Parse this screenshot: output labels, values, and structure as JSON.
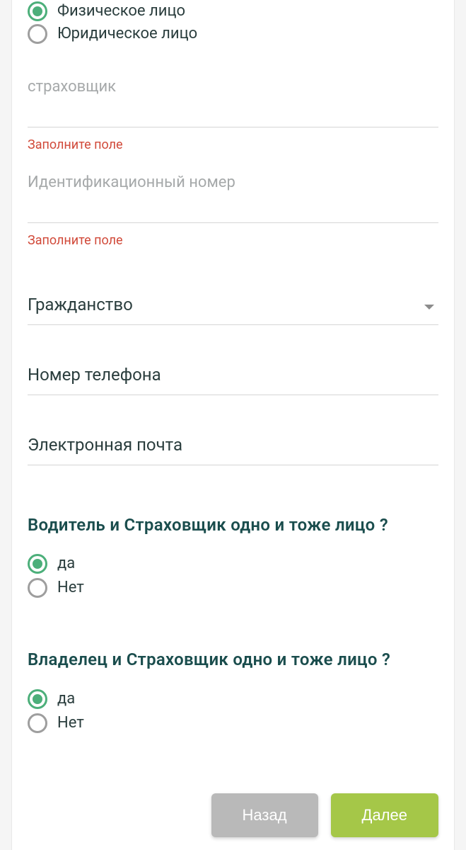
{
  "entity": {
    "options": [
      {
        "label": "Физическое лицо",
        "selected": true
      },
      {
        "label": "Юридическое лицо",
        "selected": false
      }
    ]
  },
  "fields": {
    "insurer": {
      "label": "страховщик",
      "value": "",
      "error": "Заполните поле"
    },
    "id_number": {
      "label": "Идентификационный номер",
      "value": "",
      "error": "Заполните поле"
    },
    "citizenship": {
      "label": "Гражданство",
      "value": ""
    },
    "phone": {
      "label": "Номер телефона",
      "value": ""
    },
    "email": {
      "label": "Электронная почта",
      "value": ""
    }
  },
  "question1": {
    "title": "Водитель и Страховщик одно и тоже лицо ?",
    "options": [
      {
        "label": "да",
        "selected": true
      },
      {
        "label": "Нет",
        "selected": false
      }
    ]
  },
  "question2": {
    "title": "Владелец и Страховщик одно и тоже лицо ?",
    "options": [
      {
        "label": "да",
        "selected": true
      },
      {
        "label": "Нет",
        "selected": false
      }
    ]
  },
  "buttons": {
    "back": "Назад",
    "next": "Далее"
  }
}
